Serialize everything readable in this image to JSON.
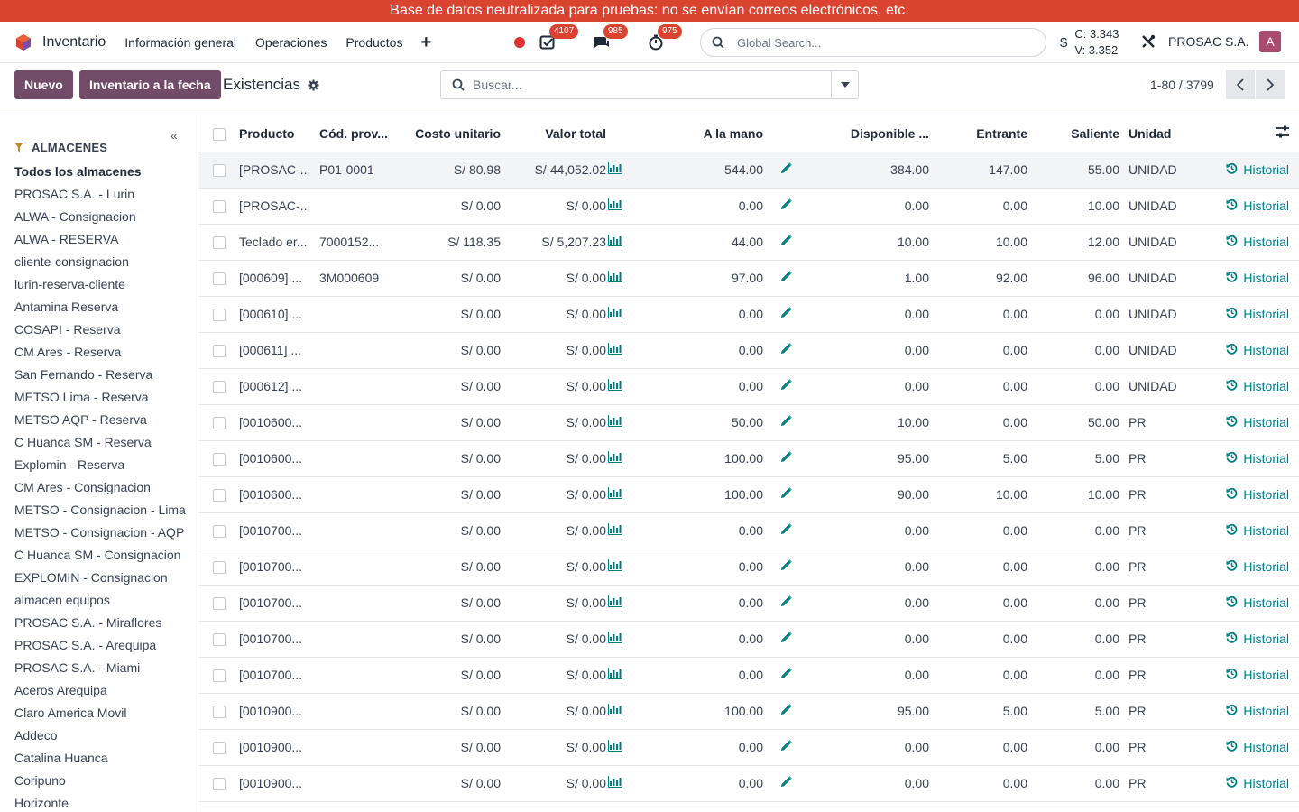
{
  "banner": "Base de datos neutralizada para pruebas: no se envían correos electrónicos, etc.",
  "navbar": {
    "app_name": "Inventario",
    "menu": [
      "Información general",
      "Operaciones",
      "Productos"
    ],
    "plus": "+",
    "badges": {
      "activities": "4107",
      "messages": "985",
      "timers": "975"
    },
    "search_placeholder": "Global Search...",
    "currency_symbol": "$",
    "rate_c": "C: 3.343",
    "rate_v": "V: 3.352",
    "company": "PROSAC S.A.",
    "avatar": "A"
  },
  "control": {
    "new_label": "Nuevo",
    "inventory_date_label": "Inventario a la fecha",
    "title": "Existencias",
    "search_placeholder": "Buscar...",
    "pager": "1-80 / 3799"
  },
  "sidebar": {
    "collapse": "«",
    "header": "ALMACENES",
    "items": [
      "Todos los almacenes",
      "PROSAC S.A. - Lurin",
      "ALWA - Consignacion",
      "ALWA - RESERVA",
      "cliente-consignacion",
      "lurin-reserva-cliente",
      "Antamina Reserva",
      "COSAPI - Reserva",
      "CM Ares - Reserva",
      "San Fernando - Reserva",
      "METSO Lima - Reserva",
      "METSO AQP - Reserva",
      "C Huanca SM - Reserva",
      "Explomin - Reserva",
      "CM Ares - Consignacion",
      "METSO - Consignacion - Lima",
      "METSO - Consignacion - AQP",
      "C Huanca SM - Consignacion",
      "EXPLOMIN - Consignacion",
      "almacen equipos",
      "PROSAC S.A. - Miraflores",
      "PROSAC S.A. - Arequipa",
      "PROSAC S.A. - Miami",
      "Aceros Arequipa",
      "Claro America Movil",
      "Addeco",
      "Catalina Huanca",
      "Coripuno",
      "Horizonte"
    ]
  },
  "table": {
    "columns": {
      "producto": "Producto",
      "cod": "Cód. prov...",
      "costo": "Costo unitario",
      "valor": "Valor total",
      "mano": "A la mano",
      "disponible": "Disponible ...",
      "entrante": "Entrante",
      "saliente": "Saliente",
      "unidad": "Unidad"
    },
    "history_label": "Historial",
    "rows": [
      {
        "producto": "[PROSAC-...",
        "cod": "P01-0001",
        "costo": "S/ 80.98",
        "valor": "S/ 44,052.02",
        "mano": "544.00",
        "disponible": "384.00",
        "entrante": "147.00",
        "saliente": "55.00",
        "unidad": "UNIDAD"
      },
      {
        "producto": "[PROSAC-...",
        "cod": "",
        "costo": "S/ 0.00",
        "valor": "S/ 0.00",
        "mano": "0.00",
        "disponible": "0.00",
        "entrante": "0.00",
        "saliente": "10.00",
        "unidad": "UNIDAD"
      },
      {
        "producto": "Teclado er...",
        "cod": "7000152...",
        "costo": "S/ 118.35",
        "valor": "S/ 5,207.23",
        "mano": "44.00",
        "disponible": "10.00",
        "entrante": "10.00",
        "saliente": "12.00",
        "unidad": "UNIDAD"
      },
      {
        "producto": "[000609] ...",
        "cod": "3M000609",
        "costo": "S/ 0.00",
        "valor": "S/ 0.00",
        "mano": "97.00",
        "disponible": "1.00",
        "entrante": "92.00",
        "saliente": "96.00",
        "unidad": "UNIDAD"
      },
      {
        "producto": "[000610] ...",
        "cod": "",
        "costo": "S/ 0.00",
        "valor": "S/ 0.00",
        "mano": "0.00",
        "disponible": "0.00",
        "entrante": "0.00",
        "saliente": "0.00",
        "unidad": "UNIDAD"
      },
      {
        "producto": "[000611] ...",
        "cod": "",
        "costo": "S/ 0.00",
        "valor": "S/ 0.00",
        "mano": "0.00",
        "disponible": "0.00",
        "entrante": "0.00",
        "saliente": "0.00",
        "unidad": "UNIDAD"
      },
      {
        "producto": "[000612] ...",
        "cod": "",
        "costo": "S/ 0.00",
        "valor": "S/ 0.00",
        "mano": "0.00",
        "disponible": "0.00",
        "entrante": "0.00",
        "saliente": "0.00",
        "unidad": "UNIDAD"
      },
      {
        "producto": "[0010600...",
        "cod": "",
        "costo": "S/ 0.00",
        "valor": "S/ 0.00",
        "mano": "50.00",
        "disponible": "10.00",
        "entrante": "0.00",
        "saliente": "50.00",
        "unidad": "PR"
      },
      {
        "producto": "[0010600...",
        "cod": "",
        "costo": "S/ 0.00",
        "valor": "S/ 0.00",
        "mano": "100.00",
        "disponible": "95.00",
        "entrante": "5.00",
        "saliente": "5.00",
        "unidad": "PR"
      },
      {
        "producto": "[0010600...",
        "cod": "",
        "costo": "S/ 0.00",
        "valor": "S/ 0.00",
        "mano": "100.00",
        "disponible": "90.00",
        "entrante": "10.00",
        "saliente": "10.00",
        "unidad": "PR"
      },
      {
        "producto": "[0010700...",
        "cod": "",
        "costo": "S/ 0.00",
        "valor": "S/ 0.00",
        "mano": "0.00",
        "disponible": "0.00",
        "entrante": "0.00",
        "saliente": "0.00",
        "unidad": "PR"
      },
      {
        "producto": "[0010700...",
        "cod": "",
        "costo": "S/ 0.00",
        "valor": "S/ 0.00",
        "mano": "0.00",
        "disponible": "0.00",
        "entrante": "0.00",
        "saliente": "0.00",
        "unidad": "PR"
      },
      {
        "producto": "[0010700...",
        "cod": "",
        "costo": "S/ 0.00",
        "valor": "S/ 0.00",
        "mano": "0.00",
        "disponible": "0.00",
        "entrante": "0.00",
        "saliente": "0.00",
        "unidad": "PR"
      },
      {
        "producto": "[0010700...",
        "cod": "",
        "costo": "S/ 0.00",
        "valor": "S/ 0.00",
        "mano": "0.00",
        "disponible": "0.00",
        "entrante": "0.00",
        "saliente": "0.00",
        "unidad": "PR"
      },
      {
        "producto": "[0010700...",
        "cod": "",
        "costo": "S/ 0.00",
        "valor": "S/ 0.00",
        "mano": "0.00",
        "disponible": "0.00",
        "entrante": "0.00",
        "saliente": "0.00",
        "unidad": "PR"
      },
      {
        "producto": "[0010900...",
        "cod": "",
        "costo": "S/ 0.00",
        "valor": "S/ 0.00",
        "mano": "100.00",
        "disponible": "95.00",
        "entrante": "5.00",
        "saliente": "5.00",
        "unidad": "PR"
      },
      {
        "producto": "[0010900...",
        "cod": "",
        "costo": "S/ 0.00",
        "valor": "S/ 0.00",
        "mano": "0.00",
        "disponible": "0.00",
        "entrante": "0.00",
        "saliente": "0.00",
        "unidad": "PR"
      },
      {
        "producto": "[0010900...",
        "cod": "",
        "costo": "S/ 0.00",
        "valor": "S/ 0.00",
        "mano": "0.00",
        "disponible": "0.00",
        "entrante": "0.00",
        "saliente": "0.00",
        "unidad": "PR"
      }
    ]
  }
}
